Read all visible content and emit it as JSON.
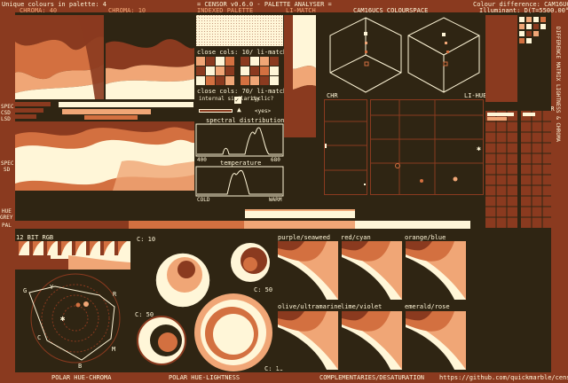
{
  "colors": {
    "dark": "#2f2513",
    "rust": "#8a3a1f",
    "orange": "#d37040",
    "peach": "#f0a676",
    "cream": "#fff6d8"
  },
  "header": {
    "unique_colours": "Unique colours in palette: 4",
    "title": "= CENSOR v0.6.0 - PALETTE ANALYSER =",
    "colour_difference": "Colour difference: CAM16UCS",
    "illuminant": "Illuminant: D(T=5500.00°K)",
    "chroma_label": "CHROMA: 40",
    "chroma_label2": "CHROMA: 10",
    "indexed_palette": "INDEXED PALETTE",
    "li_match": "LI-MATCH",
    "cam16_colourspace": "CAM16UCS COLOURSPACE"
  },
  "left_side_labels": {
    "spec": "SPEC",
    "csd": "CSD",
    "lsd": "LSD",
    "spec2": "SPEC",
    "sd": "SD",
    "hue": "HUE",
    "grey": "GREY",
    "pal": "PAL"
  },
  "palette_panel": {
    "close_cols_1": "close cols: 10/ li-match",
    "close_cols_2": "close cols: 70/ li-match",
    "internal_similarity": "internal similarity",
    "cyclic": "cyclic?",
    "yes": "<yes>",
    "spectral_distribution": "spectral distribution",
    "spec_min": "400",
    "spec_max": "680",
    "temperature": "temperature",
    "cold": "COLD",
    "warm": "WARM"
  },
  "chr_plot": {
    "chr_label": "CHR",
    "li_hue_label": "LI-HUE"
  },
  "li_chr": {
    "li": "LI",
    "chr": "CHR",
    "vertical_text": "DIFFERENCE MATRIX LIGHTNESS & CHROMA"
  },
  "bottom": {
    "bit_rgb": "12 BIT RGB",
    "c10": "C: 10",
    "c50": "C: 50",
    "c50b": "C: 50",
    "c10b": "C: 10",
    "polar_hue_chroma": "POLAR HUE-CHROMA",
    "polar_hue_lightness": "POLAR HUE-LIGHTNESS",
    "complementaries": "COMPLEMENTARIES/DESATURATION",
    "github": "https://github.com/quickmarble/censor",
    "pairs": [
      "purple/seaweed",
      "red/cyan",
      "orange/blue",
      "olive/ultramarine",
      "lime/violet",
      "emerald/rose"
    ],
    "polar_letters": [
      "G",
      "Y",
      "R",
      "C",
      "M",
      "B"
    ]
  },
  "swatches": [
    "#2f2513",
    "#8a3a1f",
    "#f0a676",
    "#fff6d8"
  ]
}
